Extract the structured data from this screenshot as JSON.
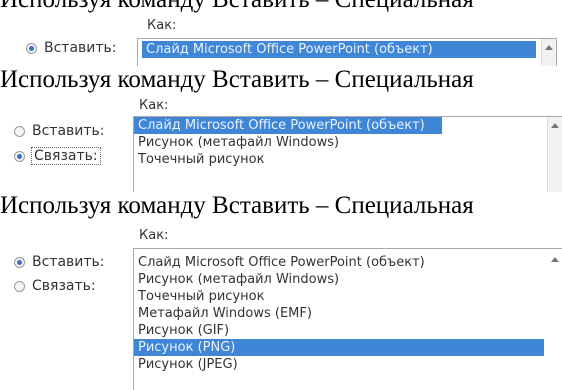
{
  "caption": "Используя команду Вставить – Специальная",
  "kak_label": "Как:",
  "panel1": {
    "paste_label": "Вставить:",
    "items": [
      "Слайд Microsoft Office PowerPoint (объект)"
    ],
    "selected_index": 0
  },
  "panel2": {
    "paste_label": "Вставить:",
    "link_label": "Связать:",
    "items": [
      "Слайд Microsoft Office PowerPoint (объект)",
      "Рисунок (метафайл Windows)",
      "Точечный рисунок"
    ],
    "selected_index": 0
  },
  "panel3": {
    "paste_label": "Вставить:",
    "link_label": "Связать:",
    "items": [
      "Слайд Microsoft Office PowerPoint (объект)",
      "Рисунок (метафайл Windows)",
      "Точечный рисунок",
      "Метафайл Windows (EMF)",
      "Рисунок (GIF)",
      "Рисунок (PNG)",
      "Рисунок (JPEG)"
    ],
    "selected_index": 5
  },
  "colors": {
    "selection": "#3f86d6",
    "radio_on": "#3a6ec9"
  }
}
